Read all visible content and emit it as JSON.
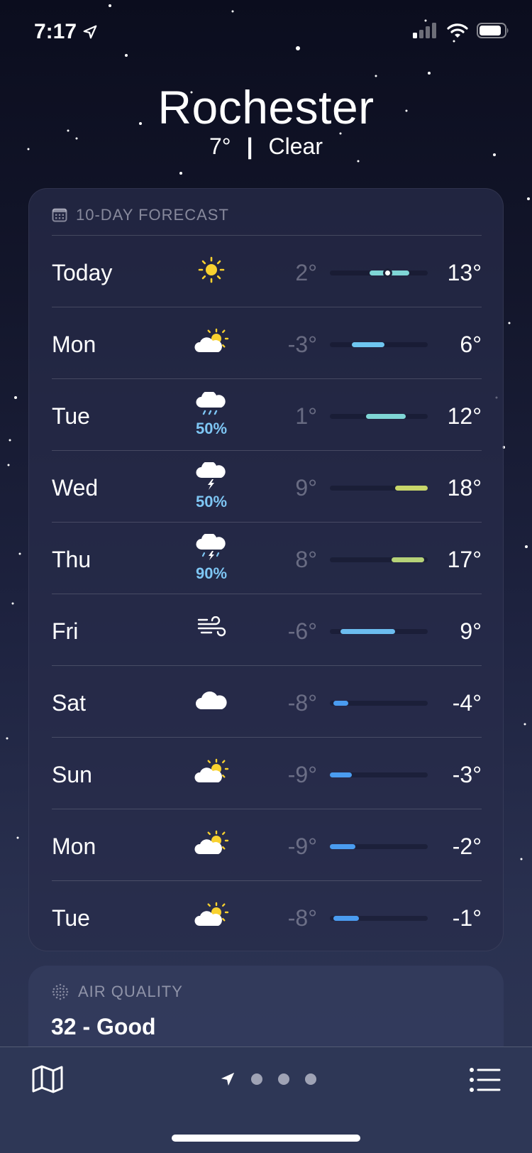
{
  "status": {
    "time": "7:17"
  },
  "location": {
    "city": "Rochester",
    "temp": "7°",
    "separator": "|",
    "condition": "Clear"
  },
  "forecast": {
    "title": "10-DAY FORECAST",
    "range_min": -9,
    "range_max": 18,
    "days": [
      {
        "day": "Today",
        "icon": "sun-icon",
        "precip": "",
        "low": "2°",
        "high": "13°",
        "low_v": 2,
        "high_v": 13,
        "current_v": 7,
        "color": "#7fd6d6"
      },
      {
        "day": "Mon",
        "icon": "partly-cloudy-icon",
        "precip": "",
        "low": "-3°",
        "high": "6°",
        "low_v": -3,
        "high_v": 6,
        "color": "#6fc6f0"
      },
      {
        "day": "Tue",
        "icon": "cloud-rain-icon",
        "precip": "50%",
        "low": "1°",
        "high": "12°",
        "low_v": 1,
        "high_v": 12,
        "color": "#7fd6d6"
      },
      {
        "day": "Wed",
        "icon": "cloud-lightning-icon",
        "precip": "50%",
        "low": "9°",
        "high": "18°",
        "low_v": 9,
        "high_v": 18,
        "color": "#c8d66a"
      },
      {
        "day": "Thu",
        "icon": "cloud-storm-rain-icon",
        "precip": "90%",
        "low": "8°",
        "high": "17°",
        "low_v": 8,
        "high_v": 17,
        "color": "#b6d278"
      },
      {
        "day": "Fri",
        "icon": "wind-icon",
        "precip": "",
        "low": "-6°",
        "high": "9°",
        "low_v": -6,
        "high_v": 9,
        "color": "#6cbcef"
      },
      {
        "day": "Sat",
        "icon": "cloud-icon",
        "precip": "",
        "low": "-8°",
        "high": "-4°",
        "low_v": -8,
        "high_v": -4,
        "color": "#4a9cf0"
      },
      {
        "day": "Sun",
        "icon": "partly-cloudy-icon",
        "precip": "",
        "low": "-9°",
        "high": "-3°",
        "low_v": -9,
        "high_v": -3,
        "color": "#4a9cf0"
      },
      {
        "day": "Mon",
        "icon": "partly-cloudy-icon",
        "precip": "",
        "low": "-9°",
        "high": "-2°",
        "low_v": -9,
        "high_v": -2,
        "color": "#4a9cf0"
      },
      {
        "day": "Tue",
        "icon": "partly-cloudy-icon",
        "precip": "",
        "low": "-8°",
        "high": "-1°",
        "low_v": -8,
        "high_v": -1,
        "color": "#4a9cf0"
      }
    ]
  },
  "air_quality": {
    "title": "AIR QUALITY",
    "value": "32 - Good"
  },
  "toolbar": {
    "pages": 3
  }
}
